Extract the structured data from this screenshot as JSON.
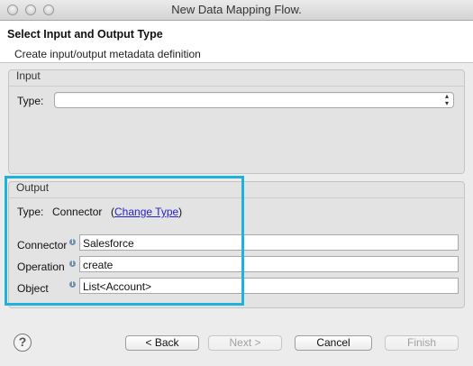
{
  "window": {
    "title": "New Data Mapping Flow.",
    "close_glyph": "×",
    "minimize_glyph": "−",
    "maximize_glyph": "+"
  },
  "header": {
    "title": "Select Input and Output Type",
    "description": "Create input/output metadata definition"
  },
  "input": {
    "group_label": "Input",
    "type_label": "Type:",
    "type_value": ""
  },
  "output": {
    "group_label": "Output",
    "type_label": "Type:",
    "type_value": "Connector",
    "change_type_open": "(",
    "change_type_link": "Change Type",
    "change_type_close": ")",
    "fields": [
      {
        "label": "Connector",
        "value": "Salesforce"
      },
      {
        "label": "Operation",
        "value": "create"
      },
      {
        "label": "Object",
        "value": "List<Account>"
      }
    ]
  },
  "buttons": {
    "help": "?",
    "back": "< Back",
    "next": "Next >",
    "cancel": "Cancel",
    "finish": "Finish"
  },
  "icons": {
    "info": "info-icon",
    "help": "help-icon"
  },
  "colors": {
    "highlight": "#1fb2dc",
    "link": "#2a21c6"
  }
}
